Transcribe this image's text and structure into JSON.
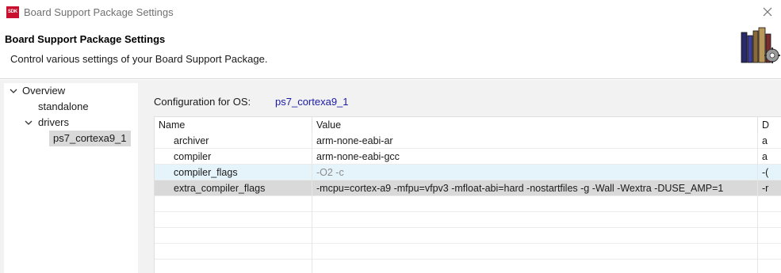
{
  "window": {
    "app_badge": "SDK",
    "title": "Board Support Package Settings"
  },
  "header": {
    "title": "Board Support Package Settings",
    "description": "Control various settings of your Board Support Package."
  },
  "tree": {
    "overview": "Overview",
    "standalone": "standalone",
    "drivers": "drivers",
    "ps7": "ps7_cortexa9_1"
  },
  "config": {
    "label": "Configuration for OS:",
    "value": "ps7_cortexa9_1"
  },
  "table": {
    "columns": {
      "name": "Name",
      "value": "Value",
      "desc": "D"
    },
    "rows": [
      {
        "name": "archiver",
        "value": "arm-none-eabi-ar",
        "desc": "a"
      },
      {
        "name": "compiler",
        "value": "arm-none-eabi-gcc",
        "desc": "a"
      },
      {
        "name": "compiler_flags",
        "value": "-O2 -c",
        "desc": "-("
      },
      {
        "name": "extra_compiler_flags",
        "value": "-mcpu=cortex-a9 -mfpu=vfpv3 -mfloat-abi=hard -nostartfiles -g -Wall -Wextra -DUSE_AMP=1",
        "desc": "-r"
      }
    ]
  }
}
